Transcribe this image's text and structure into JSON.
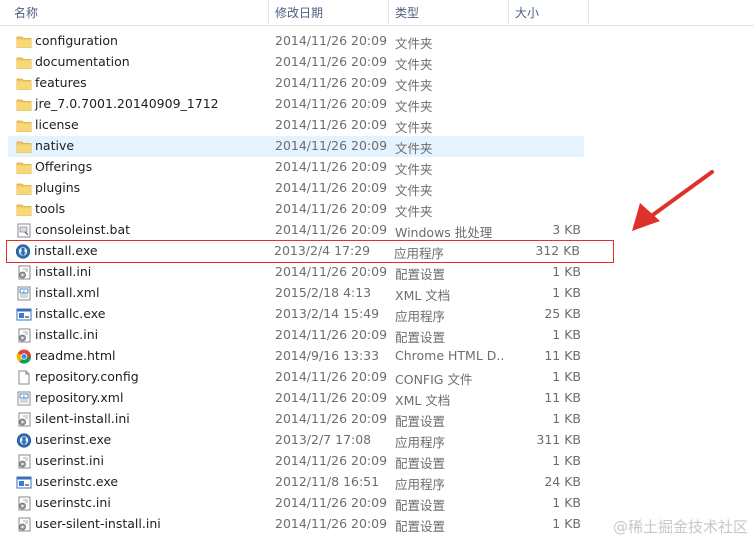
{
  "header": {
    "name_label": "名称",
    "date_label": "修改日期",
    "type_label": "类型",
    "size_label": "大小"
  },
  "files": [
    {
      "name": "configuration",
      "date": "2014/11/26 20:09",
      "type": "文件夹",
      "size": "",
      "icon": "folder-icon"
    },
    {
      "name": "documentation",
      "date": "2014/11/26 20:09",
      "type": "文件夹",
      "size": "",
      "icon": "folder-icon"
    },
    {
      "name": "features",
      "date": "2014/11/26 20:09",
      "type": "文件夹",
      "size": "",
      "icon": "folder-icon"
    },
    {
      "name": "jre_7.0.7001.20140909_1712",
      "date": "2014/11/26 20:09",
      "type": "文件夹",
      "size": "",
      "icon": "folder-icon"
    },
    {
      "name": "license",
      "date": "2014/11/26 20:09",
      "type": "文件夹",
      "size": "",
      "icon": "folder-icon"
    },
    {
      "name": "native",
      "date": "2014/11/26 20:09",
      "type": "文件夹",
      "size": "",
      "icon": "folder-icon"
    },
    {
      "name": "Offerings",
      "date": "2014/11/26 20:09",
      "type": "文件夹",
      "size": "",
      "icon": "folder-icon"
    },
    {
      "name": "plugins",
      "date": "2014/11/26 20:09",
      "type": "文件夹",
      "size": "",
      "icon": "folder-icon"
    },
    {
      "name": "tools",
      "date": "2014/11/26 20:09",
      "type": "文件夹",
      "size": "",
      "icon": "folder-icon"
    },
    {
      "name": "consoleinst.bat",
      "date": "2014/11/26 20:09",
      "type": "Windows 批处理",
      "size": "3 KB",
      "icon": "batch-file-icon"
    },
    {
      "name": "install.exe",
      "date": "2013/2/4 17:29",
      "type": "应用程序",
      "size": "312 KB",
      "icon": "installer-exe-icon"
    },
    {
      "name": "install.ini",
      "date": "2014/11/26 20:09",
      "type": "配置设置",
      "size": "1 KB",
      "icon": "ini-file-icon"
    },
    {
      "name": "install.xml",
      "date": "2015/2/18 4:13",
      "type": "XML 文档",
      "size": "1 KB",
      "icon": "xml-file-icon"
    },
    {
      "name": "installc.exe",
      "date": "2013/2/14 15:49",
      "type": "应用程序",
      "size": "25 KB",
      "icon": "console-exe-icon"
    },
    {
      "name": "installc.ini",
      "date": "2014/11/26 20:09",
      "type": "配置设置",
      "size": "1 KB",
      "icon": "ini-file-icon"
    },
    {
      "name": "readme.html",
      "date": "2014/9/16 13:33",
      "type": "Chrome HTML D...",
      "size": "11 KB",
      "icon": "chrome-html-icon"
    },
    {
      "name": "repository.config",
      "date": "2014/11/26 20:09",
      "type": "CONFIG 文件",
      "size": "1 KB",
      "icon": "blank-file-icon"
    },
    {
      "name": "repository.xml",
      "date": "2014/11/26 20:09",
      "type": "XML 文档",
      "size": "11 KB",
      "icon": "xml-file-icon"
    },
    {
      "name": "silent-install.ini",
      "date": "2014/11/26 20:09",
      "type": "配置设置",
      "size": "1 KB",
      "icon": "ini-file-icon"
    },
    {
      "name": "userinst.exe",
      "date": "2013/2/7 17:08",
      "type": "应用程序",
      "size": "311 KB",
      "icon": "installer-exe-icon"
    },
    {
      "name": "userinst.ini",
      "date": "2014/11/26 20:09",
      "type": "配置设置",
      "size": "1 KB",
      "icon": "ini-file-icon"
    },
    {
      "name": "userinstc.exe",
      "date": "2012/11/8 16:51",
      "type": "应用程序",
      "size": "24 KB",
      "icon": "console-exe-icon"
    },
    {
      "name": "userinstc.ini",
      "date": "2014/11/26 20:09",
      "type": "配置设置",
      "size": "1 KB",
      "icon": "ini-file-icon"
    },
    {
      "name": "user-silent-install.ini",
      "date": "2014/11/26 20:09",
      "type": "配置设置",
      "size": "1 KB",
      "icon": "ini-file-icon"
    }
  ],
  "selected_index": 5,
  "highlighted_index": 10,
  "watermark": "@稀土掘金技术社区",
  "colors": {
    "selection": "#e5f3ff",
    "highlight_box": "#e0302a",
    "arrow": "#e0302a",
    "folder": "#f5c65a"
  }
}
